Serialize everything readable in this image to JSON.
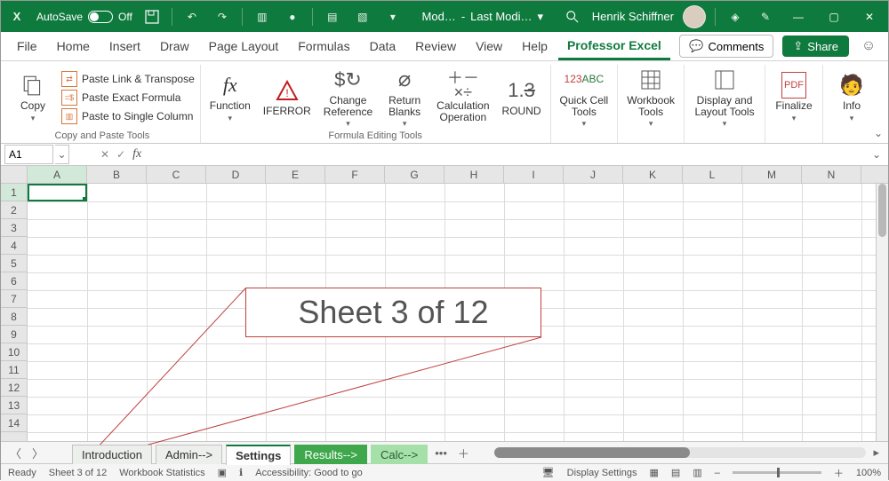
{
  "titlebar": {
    "app_short": "X",
    "autosave_label": "AutoSave",
    "autosave_state": "Off",
    "doc_left": "Mod…",
    "doc_sep": "-",
    "doc_right": "Last Modi…",
    "user_name": "Henrik Schiffner"
  },
  "menu": {
    "tabs": [
      "File",
      "Home",
      "Insert",
      "Draw",
      "Page Layout",
      "Formulas",
      "Data",
      "Review",
      "View",
      "Help",
      "Professor Excel"
    ],
    "active_index": 10,
    "comments": "Comments",
    "share": "Share"
  },
  "ribbon": {
    "copy": "Copy",
    "paste_link": "Paste Link & Transpose",
    "paste_exact": "Paste Exact Formula",
    "paste_column": "Paste to Single Column",
    "group1": "Copy and Paste Tools",
    "function": "Function",
    "iferror": "IFERROR",
    "change_ref": "Change\nReference",
    "return_blanks": "Return\nBlanks",
    "calc_op": "Calculation\nOperation",
    "round": "ROUND",
    "group2": "Formula Editing Tools",
    "quick_cell": "Quick Cell\nTools",
    "workbook": "Workbook\nTools",
    "display": "Display and\nLayout Tools",
    "finalize": "Finalize",
    "info": "Info"
  },
  "namebox": {
    "value": "A1",
    "fx": "fx"
  },
  "columns": [
    "A",
    "B",
    "C",
    "D",
    "E",
    "F",
    "G",
    "H",
    "I",
    "J",
    "K",
    "L",
    "M",
    "N"
  ],
  "rows": [
    "1",
    "2",
    "3",
    "4",
    "5",
    "6",
    "7",
    "8",
    "9",
    "10",
    "11",
    "12",
    "13",
    "14"
  ],
  "callout_text": "Sheet 3 of 12",
  "sheets": {
    "tabs": [
      {
        "label": "Introduction",
        "style": "plain"
      },
      {
        "label": "Admin-->",
        "style": "plain"
      },
      {
        "label": "Settings",
        "style": "active"
      },
      {
        "label": "Results-->",
        "style": "green"
      },
      {
        "label": "Calc-->",
        "style": "lightgreen"
      }
    ],
    "more": "•••",
    "add": "＋"
  },
  "status": {
    "ready": "Ready",
    "sheet": "Sheet 3 of 12",
    "wbstats": "Workbook Statistics",
    "access": "Accessibility: Good to go",
    "display": "Display Settings",
    "zoom": "100%"
  }
}
